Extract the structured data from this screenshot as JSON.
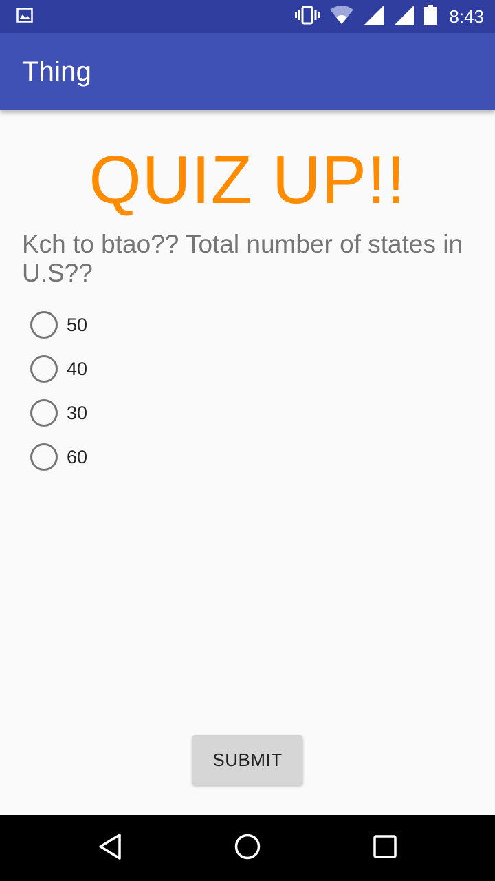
{
  "status_bar": {
    "time": "8:43",
    "icons": [
      "image-notification-icon",
      "vibrate-icon",
      "wifi-icon",
      "signal-icon",
      "signal-icon",
      "battery-icon"
    ]
  },
  "app_bar": {
    "title": "Thing"
  },
  "main": {
    "heading": "QUIZ UP!!",
    "question": "Kch to btao?? Total number of states in U.S??",
    "options": [
      "50",
      "40",
      "30",
      "60"
    ],
    "submit_label": "SUBMIT"
  },
  "nav_bar": {
    "buttons": [
      "back-icon",
      "home-icon",
      "recents-icon"
    ]
  },
  "colors": {
    "status_bar": "#303f9f",
    "app_bar": "#3f51b5",
    "heading": "#ff8c00",
    "question": "#757575",
    "button": "#d6d6d6"
  }
}
